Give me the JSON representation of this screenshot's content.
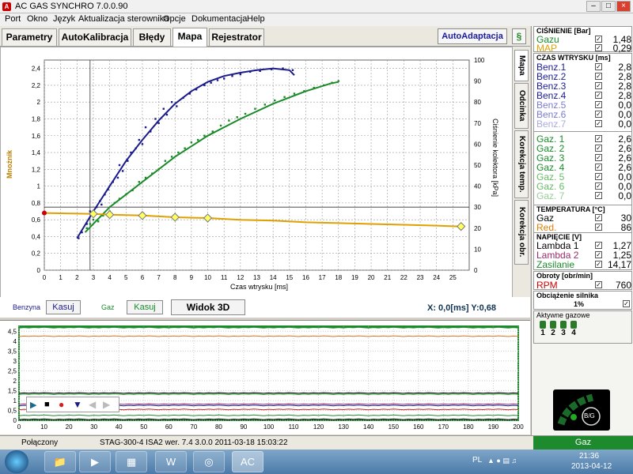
{
  "window": {
    "title": "AC GAS SYNCHRO  7.0.0.90",
    "icon": "ac-logo-icon",
    "controls": [
      "minimize-icon",
      "maximize-icon",
      "close-icon"
    ]
  },
  "menu": [
    "Port",
    "Okno",
    "Język",
    "Aktualizacja sterownika",
    "Opcje",
    "Dokumentacja",
    "Help"
  ],
  "tabs": [
    {
      "label": "Parametry"
    },
    {
      "label": "AutoKalibracja"
    },
    {
      "label": "Błędy"
    },
    {
      "label": "Mapa",
      "active": true
    },
    {
      "label": "Rejestrator"
    }
  ],
  "autoadaptacja_label": "AutoAdaptacja",
  "side_tabs": [
    {
      "label": "Mapa",
      "active": true
    },
    {
      "label": "Odcinka"
    },
    {
      "label": "Korekcja temp."
    },
    {
      "label": "Korekcja obr."
    }
  ],
  "chart_data": {
    "type": "scatter",
    "xlabel": "Czas wtrysku [ms]",
    "ylabel": "Mnożnik",
    "y2label": "Ciśnienie kolektora [kPa]",
    "xlim": [
      0,
      26
    ],
    "ylim": [
      0,
      2.5
    ],
    "y2lim": [
      0,
      100
    ],
    "x_ticks": [
      0,
      1,
      2,
      3,
      4,
      5,
      6,
      7,
      8,
      9,
      10,
      11,
      12,
      13,
      14,
      15,
      16,
      17,
      18,
      19,
      20,
      21,
      22,
      23,
      24,
      25
    ],
    "y_ticks": [
      "0",
      "0,2",
      "0,4",
      "0,6",
      "0,8",
      "1",
      "1,2",
      "1,4",
      "1,6",
      "1,8",
      "2",
      "2,2",
      "2,4"
    ],
    "y2_ticks": [
      0,
      10,
      20,
      30,
      40,
      50,
      60,
      70,
      80,
      90,
      100
    ],
    "grid": true,
    "colors": {
      "benzyna": "#1a1a8c",
      "gaz": "#1a8a2a",
      "multiplier": "#e0a000",
      "marker": "#ffff60"
    },
    "series": [
      {
        "name": "Benzyna",
        "color": "#1a1a8c",
        "curve": [
          [
            2,
            0.38
          ],
          [
            3,
            0.7
          ],
          [
            4,
            1.0
          ],
          [
            5,
            1.3
          ],
          [
            6,
            1.55
          ],
          [
            7,
            1.78
          ],
          [
            8,
            1.98
          ],
          [
            9,
            2.13
          ],
          [
            10,
            2.24
          ],
          [
            11,
            2.31
          ],
          [
            12,
            2.35
          ],
          [
            13,
            2.38
          ],
          [
            14,
            2.4
          ],
          [
            15,
            2.38
          ],
          [
            15.3,
            2.32
          ]
        ],
        "points": [
          [
            2.1,
            0.38
          ],
          [
            2.3,
            0.45
          ],
          [
            2.6,
            0.55
          ],
          [
            2.8,
            0.7
          ],
          [
            3,
            0.66
          ],
          [
            3.2,
            0.75
          ],
          [
            3.4,
            0.82
          ],
          [
            3.5,
            0.78
          ],
          [
            3.7,
            0.9
          ],
          [
            3.9,
            0.96
          ],
          [
            4.2,
            1.05
          ],
          [
            4.5,
            1.1
          ],
          [
            4.6,
            1.25
          ],
          [
            4.8,
            1.18
          ],
          [
            5.1,
            1.3
          ],
          [
            5.3,
            1.4
          ],
          [
            5.6,
            1.45
          ],
          [
            5.8,
            1.55
          ],
          [
            6,
            1.5
          ],
          [
            6.2,
            1.7
          ],
          [
            6.5,
            1.65
          ],
          [
            6.8,
            1.8
          ],
          [
            7,
            1.75
          ],
          [
            7.3,
            1.92
          ],
          [
            7.5,
            1.85
          ],
          [
            7.8,
            2.0
          ],
          [
            8.1,
            1.95
          ],
          [
            8.5,
            2.05
          ],
          [
            8.9,
            2.1
          ],
          [
            9.3,
            2.15
          ],
          [
            9.8,
            2.2
          ],
          [
            10.2,
            2.23
          ],
          [
            10.6,
            2.26
          ],
          [
            11,
            2.28
          ],
          [
            11.5,
            2.31
          ],
          [
            12,
            2.33
          ],
          [
            12.6,
            2.36
          ],
          [
            13.2,
            2.37
          ],
          [
            13.9,
            2.39
          ],
          [
            14.6,
            2.4
          ],
          [
            15.2,
            2.38
          ]
        ]
      },
      {
        "name": "Gaz",
        "color": "#1a8a2a",
        "curve": [
          [
            2.5,
            0.45
          ],
          [
            4,
            0.75
          ],
          [
            6,
            1.05
          ],
          [
            8,
            1.35
          ],
          [
            10,
            1.6
          ],
          [
            12,
            1.8
          ],
          [
            14,
            1.98
          ],
          [
            16,
            2.13
          ],
          [
            17.5,
            2.22
          ],
          [
            18,
            2.24
          ]
        ],
        "points": [
          [
            2.6,
            0.5
          ],
          [
            2.8,
            0.55
          ],
          [
            3,
            0.6
          ],
          [
            3.3,
            0.58
          ],
          [
            3.6,
            0.65
          ],
          [
            4,
            0.7
          ],
          [
            4.3,
            0.8
          ],
          [
            4.6,
            0.85
          ],
          [
            5,
            0.9
          ],
          [
            5.4,
            0.95
          ],
          [
            5.8,
            1.05
          ],
          [
            6.2,
            1.1
          ],
          [
            6.6,
            1.15
          ],
          [
            7,
            1.2
          ],
          [
            7.4,
            1.3
          ],
          [
            7.8,
            1.35
          ],
          [
            8.2,
            1.4
          ],
          [
            8.6,
            1.45
          ],
          [
            9,
            1.52
          ],
          [
            9.4,
            1.55
          ],
          [
            9.8,
            1.6
          ],
          [
            10.3,
            1.65
          ],
          [
            10.8,
            1.72
          ],
          [
            11.3,
            1.78
          ],
          [
            11.8,
            1.82
          ],
          [
            12.3,
            1.86
          ],
          [
            12.9,
            1.92
          ],
          [
            13.5,
            1.97
          ],
          [
            14.1,
            2.02
          ],
          [
            14.7,
            2.06
          ],
          [
            15.3,
            2.1
          ],
          [
            15.9,
            2.13
          ],
          [
            16.5,
            2.17
          ],
          [
            17.1,
            2.2
          ],
          [
            17.6,
            2.23
          ],
          [
            18,
            2.25
          ]
        ]
      },
      {
        "name": "Mnożnik",
        "color": "#e0a000",
        "curve": [
          [
            0,
            0.68
          ],
          [
            3,
            0.67
          ],
          [
            4,
            0.66
          ],
          [
            6,
            0.65
          ],
          [
            8,
            0.63
          ],
          [
            10,
            0.62
          ],
          [
            12,
            0.6
          ],
          [
            14,
            0.59
          ],
          [
            16,
            0.57
          ],
          [
            18,
            0.56
          ],
          [
            20,
            0.55
          ],
          [
            22,
            0.54
          ],
          [
            24,
            0.53
          ],
          [
            25.5,
            0.52
          ]
        ],
        "markers": [
          [
            3,
            0.67
          ],
          [
            4,
            0.66
          ],
          [
            6,
            0.65
          ],
          [
            8,
            0.63
          ],
          [
            10,
            0.62
          ],
          [
            25.5,
            0.52
          ]
        ]
      }
    ],
    "crosshair": {
      "x": 2.8,
      "y": 0.72
    },
    "pressure_line_kpa": 30
  },
  "controls": {
    "benzyna_label": "Benzyna",
    "kasuj_benzyna": "Kasuj",
    "gaz_label": "Gaz",
    "kasuj_gaz": "Kasuj",
    "widok3d": "Widok 3D",
    "xy_readout": "X:  0,0[ms]  Y:0,68"
  },
  "scope": {
    "y_ticks": [
      "0",
      "0,5",
      "1",
      "1,5",
      "2",
      "2,5",
      "3",
      "3,5",
      "4",
      "4,5"
    ],
    "x_ticks": [
      0,
      10,
      20,
      30,
      40,
      50,
      60,
      70,
      80,
      90,
      100,
      110,
      120,
      130,
      140,
      150,
      160,
      170,
      180,
      190,
      200
    ],
    "buttons": [
      "play-icon",
      "stop-icon",
      "record-icon",
      "down-icon",
      "prev-icon",
      "next-icon"
    ]
  },
  "status": {
    "connection": "Połączony",
    "info": "STAG-300-4 ISA2  wer. 7.4  3.0.0      2011-03-18 15:03:22",
    "fuel": "Gaz"
  },
  "right_panel": {
    "pressure": {
      "title": "CIŚNIENIE [Bar]",
      "rows": [
        {
          "label": "Gazu",
          "value": "1,48",
          "color": "#1a8a2a"
        },
        {
          "label": "MAP",
          "value": "0,29",
          "color": "#e0a000"
        }
      ]
    },
    "injection": {
      "title": "CZAS WTRYSKU [ms]",
      "benz": [
        {
          "label": "Benz.1",
          "value": "2,8",
          "color": "#1a1a9a"
        },
        {
          "label": "Benz.2",
          "value": "2,8",
          "color": "#1a1a9a"
        },
        {
          "label": "Benz.3",
          "value": "2,8",
          "color": "#1a1a9a"
        },
        {
          "label": "Benz.4",
          "value": "2,8",
          "color": "#1a1a9a"
        },
        {
          "label": "Benz.5",
          "value": "0,0",
          "color": "#7a7ad0"
        },
        {
          "label": "Benz.6",
          "value": "0,0",
          "color": "#7a7ad0"
        },
        {
          "label": "Benz.7",
          "value": "0,0",
          "color": "#aaaadd"
        }
      ],
      "gaz": [
        {
          "label": "Gaz. 1",
          "value": "2,6",
          "color": "#1a8a2a"
        },
        {
          "label": "Gaz. 2",
          "value": "2,6",
          "color": "#1a8a2a"
        },
        {
          "label": "Gaz. 3",
          "value": "2,6",
          "color": "#1a8a2a"
        },
        {
          "label": "Gaz. 4",
          "value": "2,6",
          "color": "#1a8a2a"
        },
        {
          "label": "Gaz. 5",
          "value": "0,0",
          "color": "#66bb66"
        },
        {
          "label": "Gaz. 6",
          "value": "0,0",
          "color": "#66bb66"
        },
        {
          "label": "Gaz. 7",
          "value": "0,0",
          "color": "#99cc99"
        }
      ]
    },
    "temperature": {
      "title": "TEMPERATURA  [°C]",
      "rows": [
        {
          "label": "Gaz",
          "value": "30",
          "color": "#000000"
        },
        {
          "label": "Red.",
          "value": "86",
          "color": "#e08000"
        }
      ]
    },
    "voltage": {
      "title": "NAPIĘCIE [V]",
      "rows": [
        {
          "label": "Lambda 1",
          "value": "1,27",
          "color": "#000000"
        },
        {
          "label": "Lambda 2",
          "value": "1,25",
          "color": "#9a2a6a"
        },
        {
          "label": "Zasilanie",
          "value": "14,17",
          "color": "#1a8a2a"
        }
      ]
    },
    "rpm": {
      "title": "Obroty [obr/min]",
      "label": "RPM",
      "value": "760",
      "color": "#cc0000"
    },
    "load": {
      "title": "Obciążenie silnika",
      "value": "1%"
    },
    "active_gas": {
      "title": "Aktywne gazowe",
      "injectors": [
        "1",
        "2",
        "3",
        "4"
      ]
    },
    "switch_label": "B/G"
  },
  "taskbar": {
    "lang": "PL",
    "time": "21:36",
    "date": "2013-04-12"
  }
}
